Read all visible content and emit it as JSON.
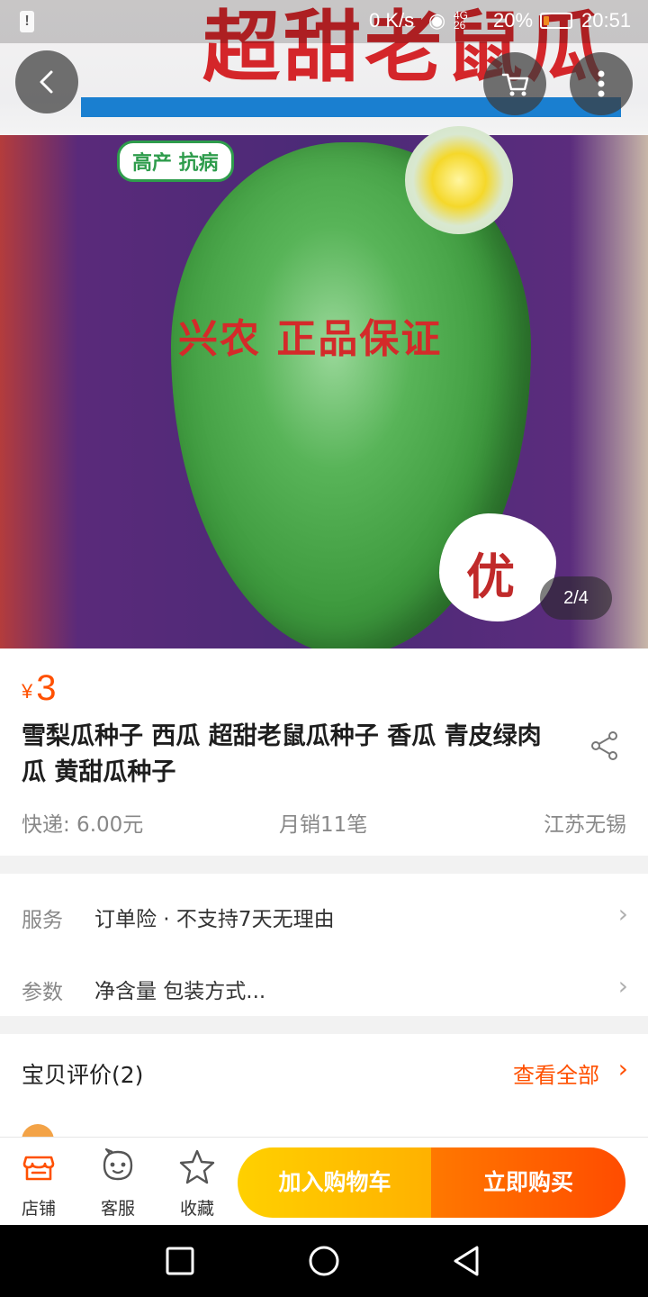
{
  "status_bar": {
    "left_alert": "!",
    "network_speed": "0 K/s",
    "signal_label": "4G",
    "signal_sub": "26",
    "battery_percent": "20%",
    "battery_level": 0.2,
    "time": "20:51"
  },
  "gallery": {
    "package_title": "超甜老鼠瓜",
    "package_tag": "高产 抗病",
    "package_slogan": "兴农 正品保证",
    "package_badge": "优",
    "counter": "2/4"
  },
  "top_buttons": {
    "back_icon": "chevron-left-icon",
    "cart_icon": "cart-icon",
    "more_icon": "more-vertical-icon"
  },
  "product": {
    "currency": "¥",
    "price": "3",
    "title": "雪梨瓜种子 西瓜 超甜老鼠瓜种子 香瓜 青皮绿肉瓜 黄甜瓜种子",
    "shipping": "快递: 6.00元",
    "monthly_sales": "月销11笔",
    "location": "江苏无锡"
  },
  "details": {
    "service_label": "服务",
    "service_value": "订单险 · 不支持7天无理由",
    "params_label": "参数",
    "params_value": "净含量 包装方式..."
  },
  "reviews": {
    "title": "宝贝评价(2)",
    "view_all": "查看全部"
  },
  "action_bar": {
    "shop_label": "店铺",
    "service_label": "客服",
    "favorite_label": "收藏",
    "add_to_cart": "加入购物车",
    "buy_now": "立即购买"
  },
  "colors": {
    "accent": "#ff5000",
    "cart_button": "#ffc200",
    "buy_button": "#ff6200"
  }
}
